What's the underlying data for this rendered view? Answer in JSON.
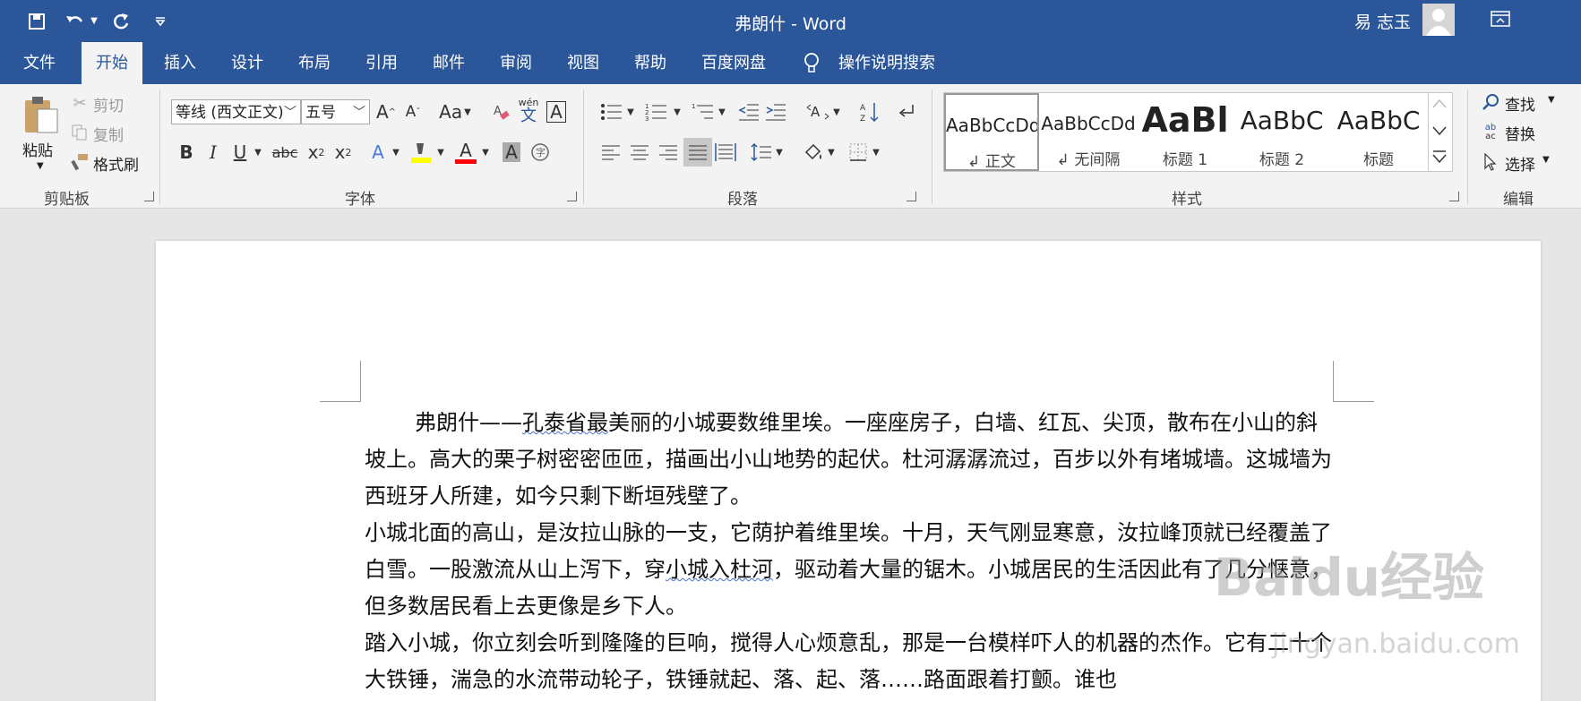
{
  "window": {
    "title": "弗朗什 - Word",
    "user": "易 志玉"
  },
  "tabs": [
    "文件",
    "开始",
    "插入",
    "设计",
    "布局",
    "引用",
    "邮件",
    "审阅",
    "视图",
    "帮助",
    "百度网盘"
  ],
  "tell_me": "操作说明搜索",
  "clipboard": {
    "paste": "粘贴",
    "cut": "剪切",
    "copy": "复制",
    "format_painter": "格式刷",
    "label": "剪贴板"
  },
  "font": {
    "name": "等线 (西文正文)",
    "size": "五号",
    "label": "字体",
    "change_case": "Aa",
    "phonetic": "wén",
    "phonetic_char": "文",
    "border_char": "A"
  },
  "paragraph": {
    "label": "段落"
  },
  "styles": {
    "label": "样式",
    "items": [
      {
        "sample": "AaBbCcDd",
        "name": "↲ 正文"
      },
      {
        "sample": "AaBbCcDd",
        "name": "↲ 无间隔"
      },
      {
        "sample": "AaBl",
        "name": "标题 1"
      },
      {
        "sample": "AaBbC",
        "name": "标题 2"
      },
      {
        "sample": "AaBbC",
        "name": "标题"
      }
    ]
  },
  "editing": {
    "find": "查找",
    "replace": "替换",
    "select": "选择",
    "label": "编辑"
  },
  "document": {
    "p1_a": "弗朗什——",
    "p1_sq": "孔泰省最",
    "p1_b": "美丽的小城要数维里埃。一座座房子，白墙、红瓦、尖顶，散布在小山的斜坡上。高大的栗子树密密匝匝，描画出小山地势的起伏。杜河潺潺流过，百步以外有堵城墙。这城墙为西班牙人所建，如今只剩下断垣残壁了。",
    "p2_a": "小城北面的高山，是汝拉山脉的一支，它荫护着维里埃。十月，天气刚显寒意，汝拉峰顶就已经覆盖了白雪。一股激流从山上泻下，穿",
    "p2_sq": "小城入杜河",
    "p2_b": "，驱动着大量的锯木。小城居民的生活因此有了几分惬意，但多数居民看上去更像是乡下人。",
    "p3": "踏入小城，你立刻会听到隆隆的巨响，搅得人心烦意乱，那是一台模样吓人的机器的杰作。它有二十个大铁锤，湍急的水流带动轮子，铁锤就起、落、起、落……路面跟着打颤。谁也"
  },
  "watermark": {
    "text": "Baidu经验",
    "url": "jingyan.baidu.com"
  },
  "colors": {
    "accent": "#2b579a",
    "highlight": "#ffff00",
    "font_color": "#ff0000"
  }
}
